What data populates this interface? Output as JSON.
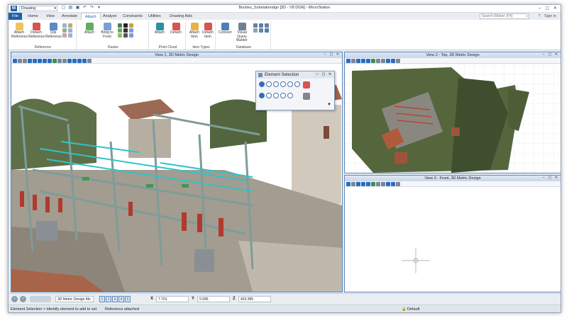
{
  "window": {
    "title": "Boulieu_Substationdgn [3D - V8 DGN] - MicroStation",
    "workspace": "Drawing",
    "logo_letter": "M"
  },
  "ribbon": {
    "tabs": [
      "File",
      "Home",
      "View",
      "Annotate",
      "Attach",
      "Analyze",
      "Constraints",
      "Utilities",
      "Drawing Aids"
    ],
    "active_tab": "Attach",
    "search_placeholder": "Search Ribbon (F4)",
    "sign_in": "Sign in",
    "groups": {
      "reference": {
        "title": "Reference",
        "buttons": [
          "Attach Reference",
          "Detach Reference",
          "Clip Reference"
        ]
      },
      "raster": {
        "title": "Raster",
        "buttons": [
          "Attach",
          "Bring to Front"
        ]
      },
      "point_cloud": {
        "title": "Point Cloud",
        "buttons": [
          "Attach",
          "Detach"
        ]
      },
      "item_types": {
        "title": "Item Types",
        "buttons": [
          "Attach Item",
          "Detach Item"
        ]
      },
      "database": {
        "title": "Database",
        "buttons": [
          "Connect",
          "Visual Query Builder"
        ]
      }
    }
  },
  "views": {
    "v1": "View 1, 3D Metric Design",
    "v2": "View 2 - Top, 3D Metric Design",
    "v3": "View 3 - Front, 3D Metric Design"
  },
  "dialog": {
    "title": "Element Selection"
  },
  "bottom": {
    "view_selector": "3D Metric Design Mo",
    "view_numbers": [
      "1",
      "2",
      "3",
      "4",
      "5"
    ],
    "x_label": "X",
    "x_value": "7.701",
    "y_label": "Y",
    "y_value": "5.585",
    "z_label": "Z",
    "z_value": "403.995"
  },
  "status": {
    "message": "Element Selection > Identify element to add to set",
    "reference": "Reference attached",
    "level": "Default"
  },
  "colors": {
    "accent": "#1f5fa8",
    "view_border": "#5f87b8",
    "steel": "#7e9c9a",
    "bus_cyan": "#2fc3c9"
  },
  "icons": [
    "attach-reference-icon",
    "detach-reference-icon",
    "clip-reference-icon",
    "raster-attach-icon",
    "point-cloud-icon",
    "database-icon",
    "search-icon"
  ]
}
